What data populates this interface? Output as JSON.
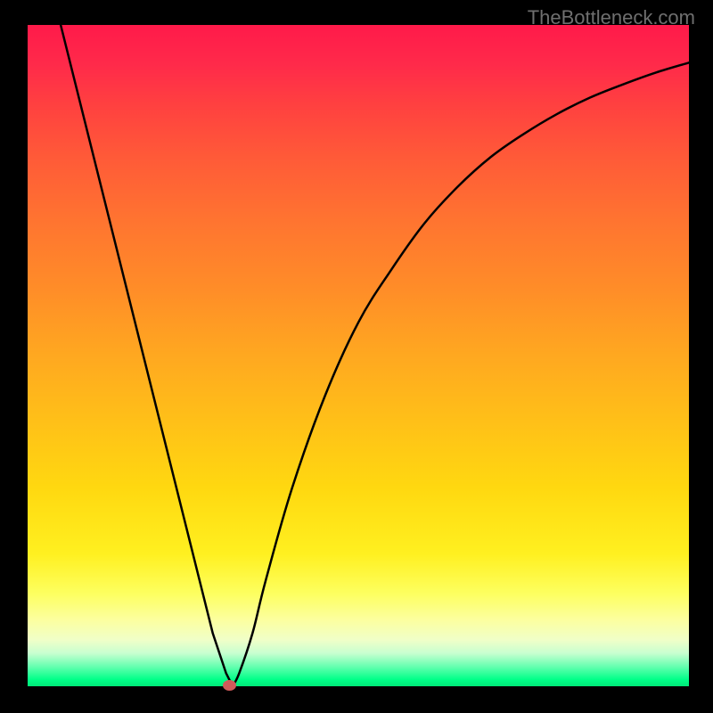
{
  "watermark": "TheBottleneck.com",
  "chart_data": {
    "type": "line",
    "title": "",
    "xlabel": "",
    "ylabel": "",
    "xlim": [
      0,
      100
    ],
    "ylim": [
      0,
      100
    ],
    "background_gradient": {
      "top_color": "#ff1a4a",
      "bottom_color": "#00e878",
      "description": "vertical gradient red→orange→yellow→green"
    },
    "series": [
      {
        "name": "bottleneck-curve",
        "description": "V-shaped black curve; steep linear descent then saturating rise",
        "x": [
          0,
          5,
          10,
          15,
          20,
          25,
          28,
          30,
          31,
          32,
          34,
          36,
          40,
          45,
          50,
          55,
          60,
          65,
          70,
          75,
          80,
          85,
          90,
          95,
          100
        ],
        "y": [
          120,
          100,
          80,
          60,
          40,
          20,
          8,
          2,
          0,
          2,
          8,
          16,
          30,
          44,
          55,
          63,
          70,
          75.5,
          80,
          83.5,
          86.5,
          89,
          91,
          92.8,
          94.3
        ]
      }
    ],
    "annotations": [
      {
        "name": "min-marker",
        "x": 30.5,
        "y": 0,
        "color": "#d05a5a",
        "shape": "ellipse"
      }
    ],
    "grid": false,
    "legend": false
  }
}
